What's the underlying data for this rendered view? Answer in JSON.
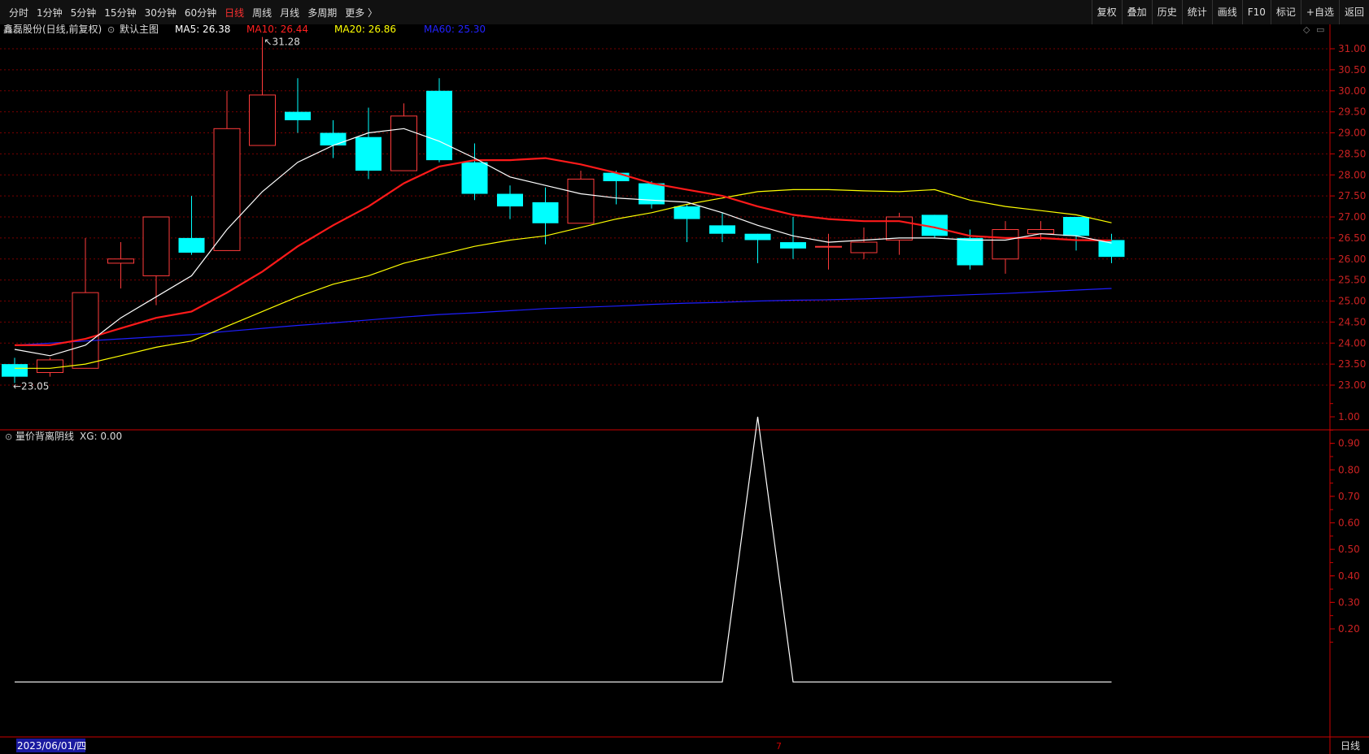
{
  "toolbar": {
    "periods": [
      "分时",
      "1分钟",
      "5分钟",
      "15分钟",
      "30分钟",
      "60分钟",
      "日线",
      "周线",
      "月线",
      "多周期",
      "更多 〉"
    ],
    "active_period": "日线",
    "tools": [
      "复权",
      "叠加",
      "历史",
      "统计",
      "画线",
      "F10",
      "标记",
      "+自选",
      "返回"
    ]
  },
  "main_panel": {
    "stock_title": "鑫磊股份(日线,前复权)",
    "template_label": "默认主图",
    "ma_labels": [
      {
        "text": "MA5: 26.38",
        "color": "#ffffff"
      },
      {
        "text": "MA10: 26.44",
        "color": "#ff2020"
      },
      {
        "text": "MA20: 26.86",
        "color": "#ffff00"
      },
      {
        "text": "MA60: 25.30",
        "color": "#2222ff"
      }
    ],
    "high_marker": "31.28",
    "low_marker": "23.05",
    "y_ticks": [
      "31.00",
      "30.50",
      "30.00",
      "29.50",
      "29.00",
      "28.50",
      "28.00",
      "27.50",
      "27.00",
      "26.50",
      "26.00",
      "25.50",
      "25.00",
      "24.50",
      "24.00",
      "23.50",
      "23.00"
    ]
  },
  "sub_panel": {
    "indicator_title": "量价背离阴线",
    "xg_label": "XG: 0.00",
    "y_ticks": [
      "1.00",
      "0.90",
      "0.80",
      "0.70",
      "0.60",
      "0.50",
      "0.40",
      "0.30",
      "0.20"
    ]
  },
  "footer": {
    "date_label": "2023/06/01/四",
    "cursor_mark": "7",
    "period_label": "日线"
  },
  "colors": {
    "up": "#ff3b3b",
    "down": "#00ffff",
    "ma5": "#ffffff",
    "ma10": "#ff1a1a",
    "ma20": "#ffff00",
    "ma60": "#1e1eff",
    "grid": "#7a0000",
    "axis": "#cc0000"
  },
  "chart_data": {
    "type": "candlestick",
    "ylim": [
      22.75,
      31.35
    ],
    "candles": [
      {
        "o": 23.5,
        "h": 23.65,
        "l": 23.05,
        "c": 23.2
      },
      {
        "o": 23.3,
        "h": 23.65,
        "l": 23.2,
        "c": 23.6
      },
      {
        "o": 23.4,
        "h": 26.5,
        "l": 23.4,
        "c": 25.2
      },
      {
        "o": 25.9,
        "h": 26.4,
        "l": 25.3,
        "c": 26.0
      },
      {
        "o": 25.6,
        "h": 27.0,
        "l": 24.9,
        "c": 27.0
      },
      {
        "o": 26.5,
        "h": 27.5,
        "l": 26.1,
        "c": 26.15
      },
      {
        "o": 26.2,
        "h": 30.0,
        "l": 26.2,
        "c": 29.1
      },
      {
        "o": 28.7,
        "h": 31.28,
        "l": 28.7,
        "c": 29.9
      },
      {
        "o": 29.5,
        "h": 30.3,
        "l": 29.0,
        "c": 29.3
      },
      {
        "o": 29.0,
        "h": 29.3,
        "l": 28.4,
        "c": 28.7
      },
      {
        "o": 28.9,
        "h": 29.6,
        "l": 27.9,
        "c": 28.1
      },
      {
        "o": 28.1,
        "h": 29.7,
        "l": 28.1,
        "c": 29.4
      },
      {
        "o": 30.0,
        "h": 30.3,
        "l": 28.3,
        "c": 28.35
      },
      {
        "o": 28.3,
        "h": 28.75,
        "l": 27.4,
        "c": 27.55
      },
      {
        "o": 27.55,
        "h": 27.75,
        "l": 26.95,
        "c": 27.25
      },
      {
        "o": 27.35,
        "h": 27.7,
        "l": 26.35,
        "c": 26.85
      },
      {
        "o": 26.85,
        "h": 28.1,
        "l": 26.85,
        "c": 27.9
      },
      {
        "o": 28.05,
        "h": 28.1,
        "l": 27.3,
        "c": 27.85
      },
      {
        "o": 27.8,
        "h": 27.85,
        "l": 27.2,
        "c": 27.3
      },
      {
        "o": 27.25,
        "h": 27.3,
        "l": 26.4,
        "c": 26.95
      },
      {
        "o": 26.8,
        "h": 27.1,
        "l": 26.4,
        "c": 26.6
      },
      {
        "o": 26.6,
        "h": 26.6,
        "l": 25.9,
        "c": 26.45
      },
      {
        "o": 26.4,
        "h": 27.0,
        "l": 26.0,
        "c": 26.25
      },
      {
        "o": 26.3,
        "h": 26.6,
        "l": 25.75,
        "c": 26.3
      },
      {
        "o": 26.15,
        "h": 26.75,
        "l": 26.0,
        "c": 26.4
      },
      {
        "o": 26.45,
        "h": 27.1,
        "l": 26.1,
        "c": 27.0
      },
      {
        "o": 27.05,
        "h": 27.05,
        "l": 26.5,
        "c": 26.55
      },
      {
        "o": 26.5,
        "h": 26.7,
        "l": 25.75,
        "c": 25.85
      },
      {
        "o": 26.0,
        "h": 26.9,
        "l": 25.65,
        "c": 26.7
      },
      {
        "o": 26.6,
        "h": 26.9,
        "l": 26.45,
        "c": 26.7
      },
      {
        "o": 27.0,
        "h": 27.0,
        "l": 26.2,
        "c": 26.55
      },
      {
        "o": 26.45,
        "h": 26.6,
        "l": 25.9,
        "c": 26.05
      }
    ],
    "ma5": [
      23.85,
      23.7,
      23.95,
      24.6,
      25.1,
      25.6,
      26.7,
      27.6,
      28.3,
      28.7,
      29.0,
      29.1,
      28.8,
      28.4,
      27.95,
      27.75,
      27.55,
      27.45,
      27.4,
      27.35,
      27.1,
      26.8,
      26.55,
      26.4,
      26.45,
      26.5,
      26.5,
      26.45,
      26.45,
      26.6,
      26.55,
      26.38
    ],
    "ma10": [
      23.95,
      23.95,
      24.1,
      24.35,
      24.6,
      24.75,
      25.2,
      25.7,
      26.3,
      26.8,
      27.25,
      27.8,
      28.2,
      28.35,
      28.35,
      28.4,
      28.25,
      28.05,
      27.8,
      27.65,
      27.5,
      27.25,
      27.05,
      26.95,
      26.9,
      26.9,
      26.75,
      26.55,
      26.5,
      26.5,
      26.45,
      26.44
    ],
    "ma20": [
      23.4,
      23.4,
      23.5,
      23.7,
      23.9,
      24.05,
      24.4,
      24.75,
      25.1,
      25.4,
      25.6,
      25.9,
      26.1,
      26.3,
      26.45,
      26.55,
      26.75,
      26.95,
      27.1,
      27.3,
      27.45,
      27.6,
      27.65,
      27.65,
      27.62,
      27.6,
      27.65,
      27.4,
      27.25,
      27.15,
      27.05,
      26.86
    ],
    "ma60": [
      23.95,
      24.0,
      24.05,
      24.1,
      24.15,
      24.2,
      24.28,
      24.35,
      24.42,
      24.48,
      24.55,
      24.62,
      24.68,
      24.72,
      24.77,
      24.82,
      24.85,
      24.88,
      24.92,
      24.95,
      24.97,
      25.0,
      25.02,
      25.03,
      25.05,
      25.08,
      25.12,
      25.15,
      25.18,
      25.22,
      25.26,
      25.3
    ],
    "xg": [
      0,
      0,
      0,
      0,
      0,
      0,
      0,
      0,
      0,
      0,
      0,
      0,
      0,
      0,
      0,
      0,
      0,
      0,
      0,
      0,
      0,
      1,
      0,
      0,
      0,
      0,
      0,
      0,
      0,
      0,
      0,
      0
    ],
    "sub_ylim": [
      0,
      1.1
    ]
  }
}
